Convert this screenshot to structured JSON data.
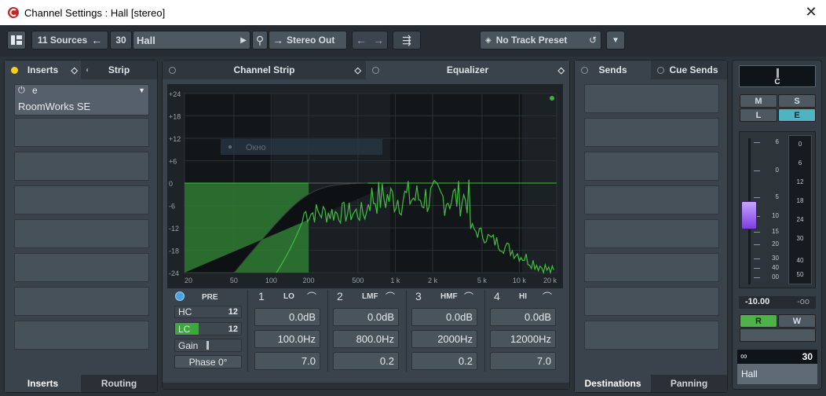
{
  "window": {
    "title": "Channel Settings : Hall [stereo]"
  },
  "toolbar": {
    "sources": "11 Sources",
    "channel_number": "30",
    "channel_name": "Hall",
    "output": "Stereo Out",
    "preset": "No Track Preset"
  },
  "inserts_panel": {
    "tab_inserts": "Inserts",
    "tab_strip": "Strip",
    "plugin_name": "RoomWorks SE",
    "bottom_inserts": "Inserts",
    "bottom_routing": "Routing"
  },
  "eq_panel": {
    "tab_channel_strip": "Channel Strip",
    "tab_equalizer": "Equalizer",
    "y_ticks": [
      "+24",
      "+18",
      "+12",
      "+6",
      "0",
      "-6",
      "-12",
      "-18",
      "-24"
    ],
    "x_ticks": [
      "20",
      "50",
      "100",
      "200",
      "500",
      "1 k",
      "2 k",
      "5 k",
      "10 k",
      "20 k"
    ],
    "tooltip": "Окно",
    "pre_label": "PRE",
    "hc_label": "HC",
    "hc_value": "12",
    "lc_label": "LC",
    "lc_value": "12",
    "gain_label": "Gain",
    "phase_label": "Phase 0°",
    "bands": [
      {
        "num": "1",
        "type": "LO",
        "gain": "0.0dB",
        "freq": "100.0Hz",
        "q": "7.0"
      },
      {
        "num": "2",
        "type": "LMF",
        "gain": "0.0dB",
        "freq": "800.0Hz",
        "q": "0.2"
      },
      {
        "num": "3",
        "type": "HMF",
        "gain": "0.0dB",
        "freq": "2000Hz",
        "q": "0.2"
      },
      {
        "num": "4",
        "type": "HI",
        "gain": "0.0dB",
        "freq": "12000Hz",
        "q": "7.0"
      }
    ],
    "colors": {
      "curve": "#3fbf3f",
      "fill": "#2f7a32"
    }
  },
  "sends_panel": {
    "tab_sends": "Sends",
    "tab_cue_sends": "Cue Sends",
    "bottom_destinations": "Destinations",
    "bottom_panning": "Panning"
  },
  "fader_panel": {
    "pan": "C",
    "mute": "M",
    "solo": "S",
    "listen": "L",
    "edit": "E",
    "fader_scale": [
      "6",
      "0",
      "5",
      "10",
      "15",
      "20",
      "30",
      "40",
      "00"
    ],
    "meter_scale": [
      "0",
      "6",
      "12",
      "18",
      "24",
      "30",
      "40",
      "50"
    ],
    "volume": "-10.00",
    "peak": "-oo",
    "read": "R",
    "write": "W",
    "channel_number": "30",
    "channel_name": "Hall"
  }
}
